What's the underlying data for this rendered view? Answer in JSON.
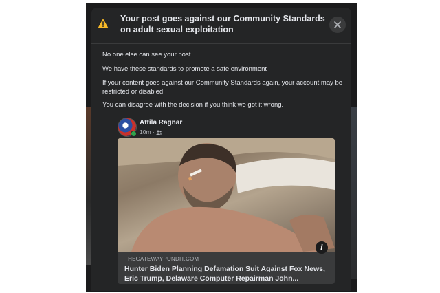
{
  "modal": {
    "title": "Your post goes against our Community Standards on adult sexual exploitation",
    "messages": [
      "No one else can see your post.",
      "We have these standards to promote a safe environment",
      "If your content goes against our Community Standards again, your account may be restricted or disabled.",
      "You can disagree with the decision if you think we got it wrong."
    ]
  },
  "post": {
    "author": "Attila Ragnar",
    "time": "10m ·",
    "audience_icon": "friends-icon"
  },
  "link": {
    "domain": "THEGATEWAYPUNDIT.COM",
    "title": "Hunter Biden Planning Defamation Suit Against Fox News, Eric Trump, Delaware Computer Repairman John...",
    "info_icon": "i"
  },
  "icons": {
    "warning": "warning-icon",
    "close": "close-icon"
  },
  "colors": {
    "warning": "#f7b928",
    "surface": "#242526",
    "text": "#e4e6eb",
    "secondary_text": "#b0b3b8"
  }
}
